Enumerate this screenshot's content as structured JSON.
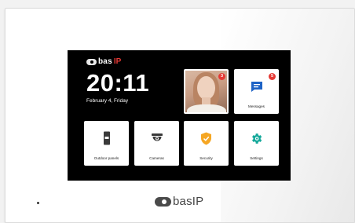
{
  "brand": {
    "logo_main": "bas",
    "logo_accent": "IP",
    "bottom_logo_text": "basIP"
  },
  "clock": {
    "time": "20:11",
    "date": "February 4, Friday"
  },
  "tiles": {
    "photo": {
      "caption": "",
      "badge": "3"
    },
    "messages": {
      "label": "Messages",
      "badge": "5",
      "icon": "message-icon"
    },
    "outdoor": {
      "label": "Outdoor panels",
      "icon": "outdoor-panel-icon"
    },
    "cameras": {
      "label": "Cameras",
      "icon": "camera-icon"
    },
    "security": {
      "label": "Security",
      "icon": "shield-icon"
    },
    "settings": {
      "label": "Settings",
      "icon": "gear-icon"
    }
  },
  "colors": {
    "accent_red": "#e53935",
    "messages_blue": "#1e63c6",
    "security_yellow": "#f5a623",
    "settings_teal": "#14a89a",
    "screen_bg": "#000000"
  }
}
